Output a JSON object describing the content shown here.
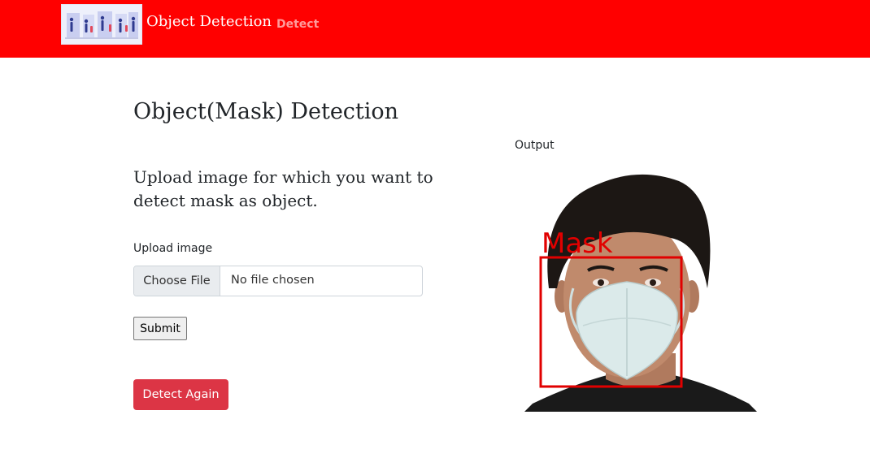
{
  "navbar": {
    "brand_text": "Object Detection",
    "links": [
      "Detect"
    ],
    "colors": {
      "background": "#ff0000",
      "link": "#ff9a9a"
    }
  },
  "main": {
    "title": "Object(Mask) Detection",
    "intro": "Upload image for which you want to detect mask as object.",
    "upload_label": "Upload image",
    "file_button_label": "Choose File",
    "file_status": "No file chosen",
    "submit_label": "Submit",
    "detect_again_label": "Detect Again",
    "detect_again_color": "#dc3545"
  },
  "output": {
    "label": "Output",
    "detection_label": "Mask",
    "box_color": "#e10000"
  }
}
